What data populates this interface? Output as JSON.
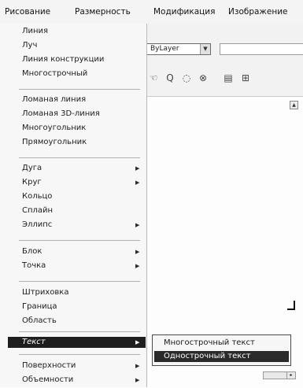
{
  "menubar": {
    "items": [
      "Рисование",
      "Размерность",
      "Модификация",
      "Изображение"
    ]
  },
  "toolbar": {
    "layer_value": "ByLayer",
    "layer_arrow": "▼",
    "icons": [
      "pan-icon",
      "zoom-icon",
      "zoom-window-icon",
      "zoom-previous-icon",
      "properties-icon",
      "design-center-icon"
    ]
  },
  "draw_menu": {
    "groups": [
      [
        "Линия",
        "Луч",
        "Линия конструкции",
        "Многострочный"
      ],
      [
        "Ломаная линия",
        "Ломаная 3D-линия",
        "Многоугольник",
        "Прямоугольник"
      ],
      [
        "Дуга",
        "Круг",
        "Кольцо",
        "Сплайн",
        "Эллипс"
      ],
      [
        "Блок",
        "Точка"
      ],
      [
        "Штриховка",
        "Граница",
        "Область"
      ],
      [
        "Текст"
      ],
      [
        "Поверхности",
        "Объемности"
      ]
    ],
    "highlighted": "Текст"
  },
  "text_submenu": {
    "items": [
      "Многострочный текст",
      "Однострочный текст"
    ],
    "highlighted": "Однострочный текст"
  },
  "colors": {
    "highlight": "#1e1e1e",
    "menu_bg": "#f7f7f7"
  }
}
